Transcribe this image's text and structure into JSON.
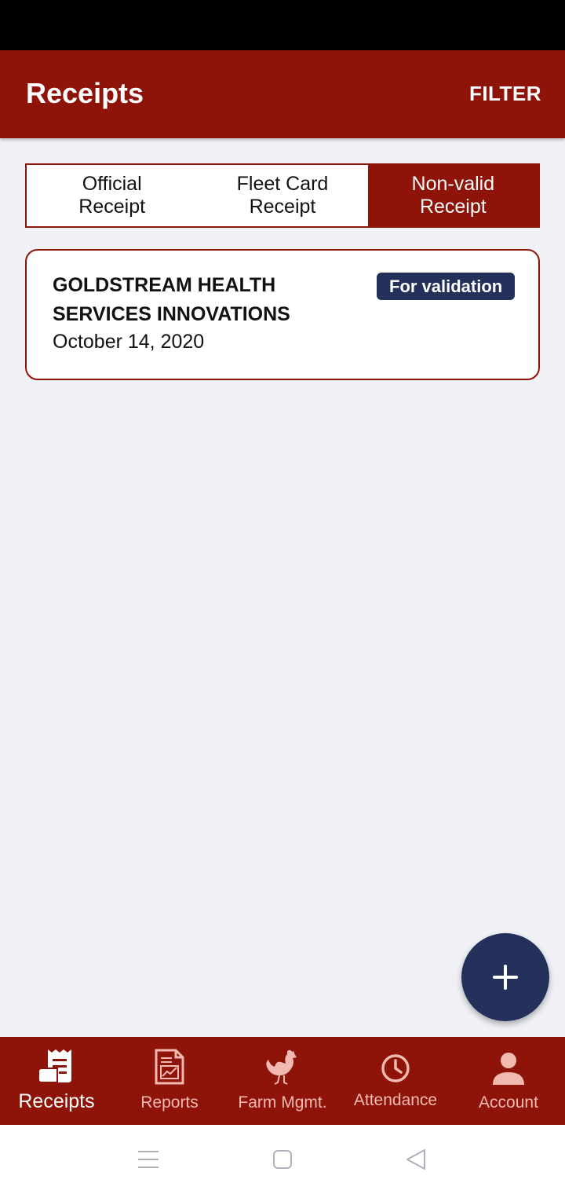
{
  "header": {
    "title": "Receipts",
    "filter_label": "FILTER"
  },
  "tabs": [
    {
      "label_line1": "Official",
      "label_line2": "Receipt",
      "active": false
    },
    {
      "label_line1": "Fleet Card",
      "label_line2": "Receipt",
      "active": false
    },
    {
      "label_line1": "Non-valid",
      "label_line2": "Receipt",
      "active": true
    }
  ],
  "receipts": [
    {
      "name": "GOLDSTREAM HEALTH SERVICES INNOVATIONS",
      "date": "October 14, 2020",
      "status": "For validation"
    }
  ],
  "fab": {
    "icon": "plus-icon"
  },
  "bottom_nav": [
    {
      "label": "Receipts",
      "icon": "receipt-icon",
      "active": true
    },
    {
      "label": "Reports",
      "icon": "report-icon",
      "active": false
    },
    {
      "label": "Farm Mgmt.",
      "icon": "chicken-icon",
      "active": false
    },
    {
      "label": "Attendance",
      "icon": "clock-icon",
      "active": false
    },
    {
      "label": "Account",
      "icon": "person-icon",
      "active": false
    }
  ],
  "colors": {
    "primary": "#8e1308",
    "secondary": "#22305a",
    "background": "#f0f1f7",
    "nav_inactive": "#f2b9b0"
  }
}
